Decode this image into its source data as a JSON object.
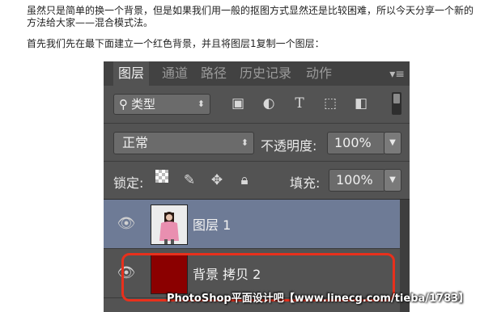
{
  "article": {
    "para1": "虽然只是简单的换一个背景，但是如果我们用一般的抠图方式显然还是比较困难，所以今天分享一个新的方法给大家——混合模式法。",
    "para2": "首先我们先在最下面建立一个红色背景，并且将图层1复制一个图层："
  },
  "panel": {
    "tabs": [
      "图层",
      "通道",
      "路径",
      "历史记录",
      "动作"
    ],
    "menu_icon": "panel-menu-icon",
    "filter": {
      "value": "类型",
      "icons": [
        "image-filter-icon",
        "adjustment-filter-icon",
        "type-filter-icon",
        "shape-filter-icon",
        "smart-object-filter-icon"
      ]
    },
    "blend_mode": "正常",
    "opacity_label": "不透明度:",
    "opacity_value": "100%",
    "lock_label": "锁定:",
    "fill_label": "填充:",
    "fill_value": "100%",
    "layers": [
      {
        "name": "图层 1",
        "selected": true,
        "thumb": "person-photo"
      },
      {
        "name": "背景 拷贝 2",
        "selected": false,
        "thumb_color": "#8b0000"
      }
    ]
  },
  "colors": {
    "panel_bg": "#535353",
    "selected_layer": "#6e7b96",
    "highlight": "#e8301c",
    "red_fill": "#8b0000"
  },
  "watermark": "PhotoShop平面设计吧【www.linecg.com/tieba/1783】"
}
